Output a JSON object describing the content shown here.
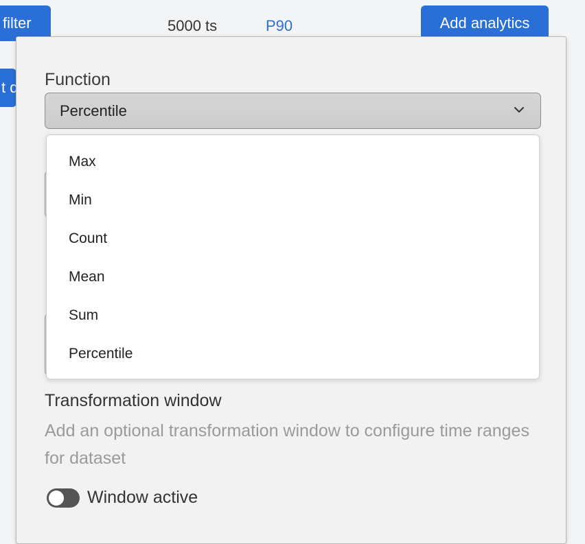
{
  "background": {
    "filter_button": "filter",
    "series_count": "5000 ts",
    "percentile_tag": "P90",
    "add_analytics_button": "Add analytics",
    "side_button_text": "t d"
  },
  "function": {
    "label": "Function",
    "selected": "Percentile",
    "options": [
      "Max",
      "Min",
      "Count",
      "Mean",
      "Sum",
      "Percentile"
    ]
  },
  "transformation": {
    "title": "Transformation window",
    "description": "Add an optional transformation window to configure time ranges for dataset",
    "toggle_label": "Window active",
    "toggle_on": false
  },
  "icons": {
    "select": "chevron-down-icon"
  },
  "colors": {
    "accent": "#2a6fd6",
    "toggle_off": "#555555"
  }
}
